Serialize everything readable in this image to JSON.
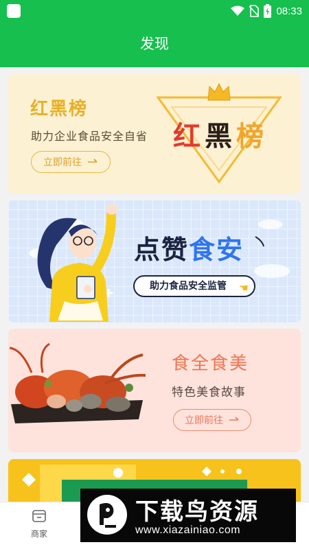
{
  "status_bar": {
    "time": "08:33",
    "icons": [
      "notification-square-icon",
      "wifi-icon",
      "no-sim-icon",
      "battery-charging-icon"
    ],
    "color": "#17bf4f"
  },
  "header": {
    "title": "发现"
  },
  "cards": {
    "red_black": {
      "title": "红黑榜",
      "subtitle": "助力企业食品安全自省",
      "button_label": "立即前往",
      "badge": {
        "part1": "红",
        "part2": "黑",
        "part3": "榜"
      },
      "bg_color": "#fcf1d2"
    },
    "dianzan": {
      "title_part1": "点赞",
      "title_part2": "食安",
      "pill_label": "助力食品安全监管",
      "bg_color": "#dbe8fb"
    },
    "food": {
      "title": "食全食美",
      "subtitle": "特色美食故事",
      "button_label": "立即前往",
      "bg_color": "#fde3dc"
    },
    "yellow": {
      "bg_color": "#f6c21b"
    }
  },
  "bottom_nav": {
    "items": [
      {
        "label": "商家",
        "icon": "store-icon"
      }
    ]
  },
  "watermark": {
    "text": "下载鸟资源",
    "url": "www.xiazainiao.com"
  }
}
